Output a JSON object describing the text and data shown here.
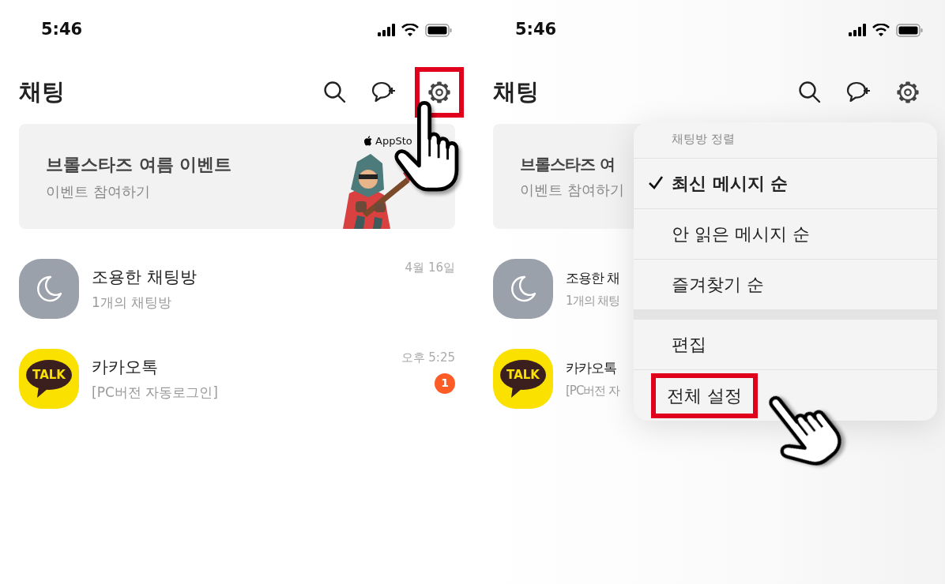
{
  "screens": [
    {
      "status_bar": {
        "time": "5:46"
      },
      "header": {
        "title": "채팅",
        "settings_highlighted": true
      },
      "banner": {
        "title": "브롤스타즈 여름 이벤트",
        "subtitle": "이벤트 참여하기",
        "store_label": "AppSto"
      },
      "chats": [
        {
          "kind": "moon",
          "name": "조용한 채팅방",
          "preview": "1개의 채팅방",
          "time": "4월 16일"
        },
        {
          "kind": "talk",
          "logo": "TALK",
          "name": "카카오톡",
          "preview": "[PC버전 자동로그인]",
          "time": "오후 5:25",
          "unread": "1"
        }
      ]
    },
    {
      "status_bar": {
        "time": "5:46"
      },
      "header": {
        "title": "채팅",
        "settings_highlighted": false
      },
      "banner": {
        "title": "브롤스타즈 여",
        "subtitle": "이벤트 참여하기"
      },
      "chats": [
        {
          "kind": "moon",
          "name": "조용한 채",
          "preview": "1개의 채팅"
        },
        {
          "kind": "talk",
          "logo": "TALK",
          "name": "카카오톡",
          "preview": "[PC버전 자"
        }
      ],
      "menu": {
        "heading": "채팅방 정렬",
        "sort_options": [
          {
            "label": "최신 메시지 순",
            "selected": true
          },
          {
            "label": "안 읽은 메시지 순",
            "selected": false
          },
          {
            "label": "즐겨찾기 순",
            "selected": false
          }
        ],
        "actions": [
          {
            "label": "편집",
            "highlighted": false
          },
          {
            "label": "전체 설정",
            "highlighted": true
          }
        ]
      }
    }
  ]
}
